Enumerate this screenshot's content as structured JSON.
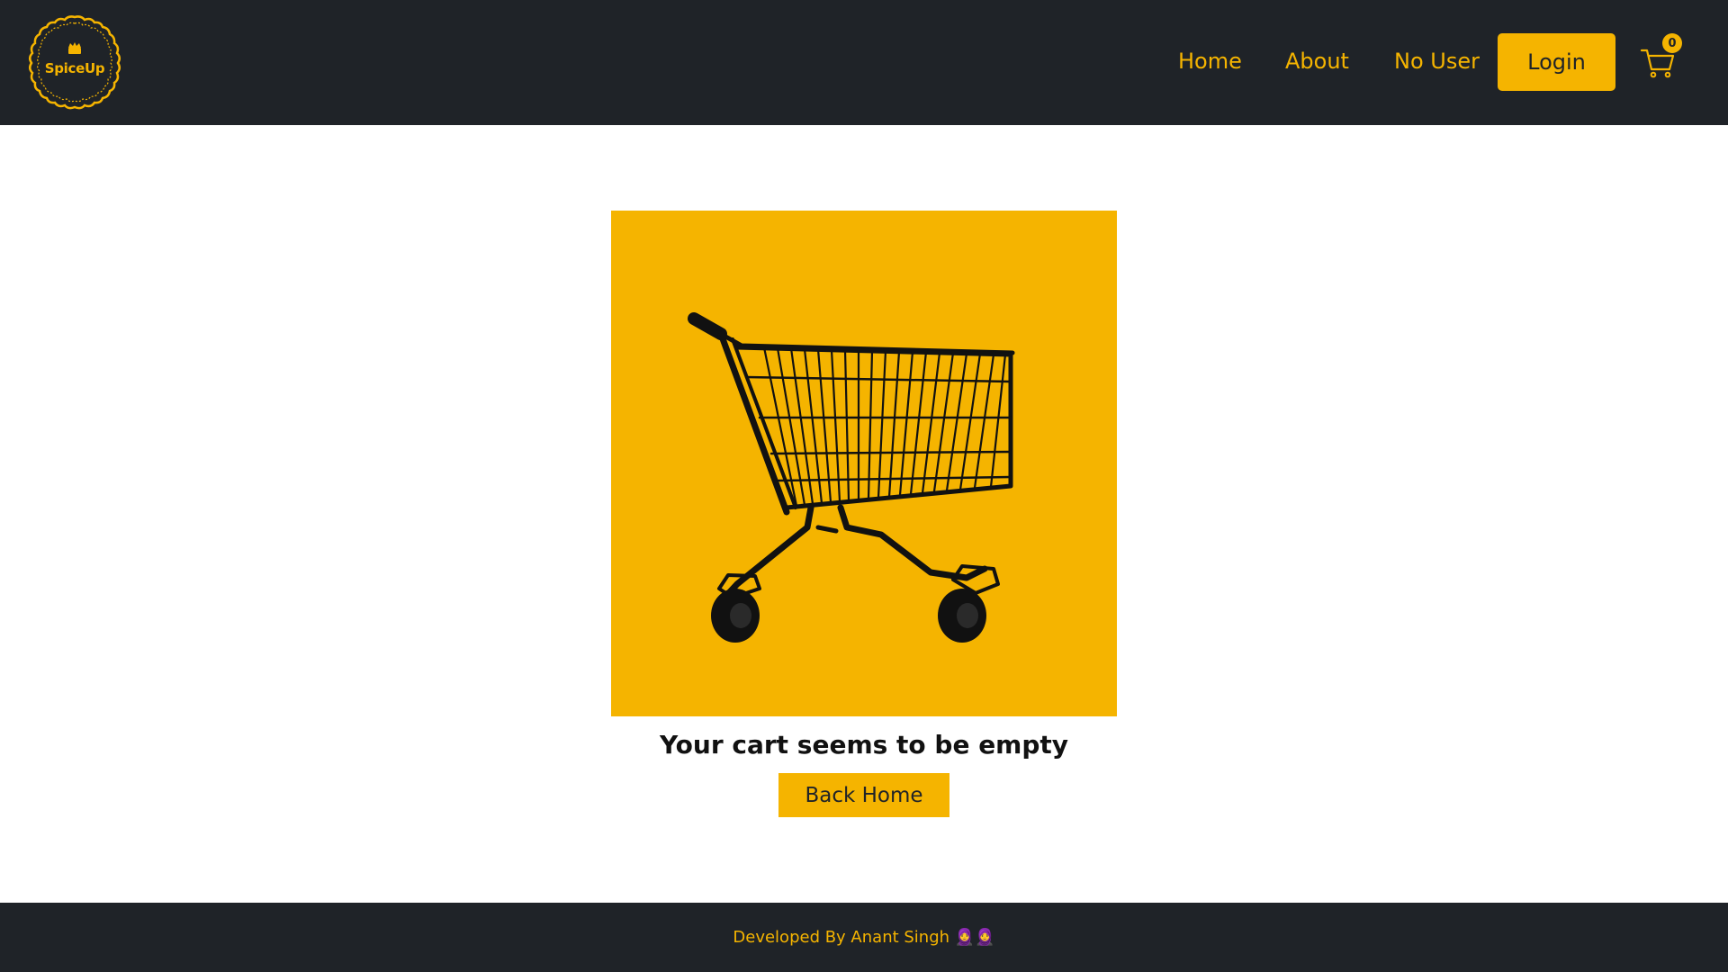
{
  "brand": {
    "logo_text": "SpiceUp",
    "accent_color": "#f5b400",
    "header_bg": "#1f2328"
  },
  "nav": {
    "home": "Home",
    "about": "About",
    "user": "No User",
    "login": "Login",
    "cart_count": "0"
  },
  "main": {
    "empty_message": "Your cart seems to be empty",
    "back_button": "Back Home",
    "image_icon": "shopping-cart-image"
  },
  "footer": {
    "text": "Developed By Anant Singh 🧕🧕"
  }
}
